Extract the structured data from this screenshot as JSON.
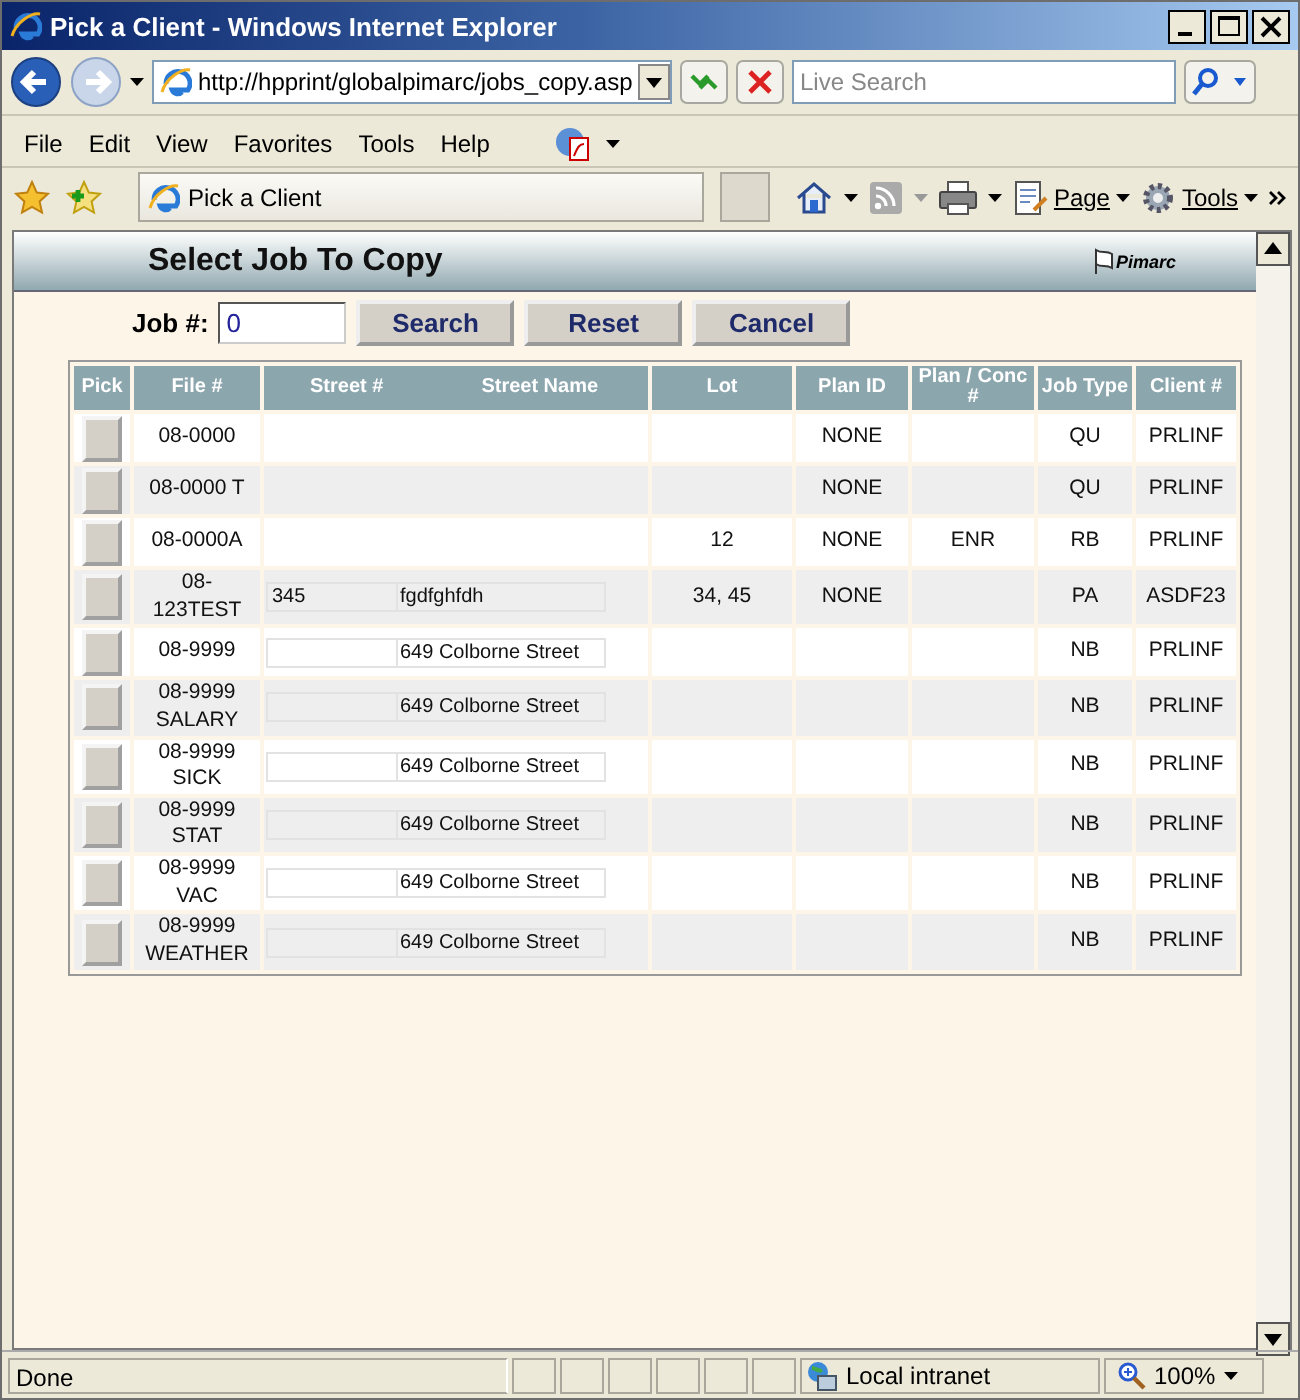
{
  "window": {
    "title": "Pick a Client - Windows Internet Explorer"
  },
  "address_bar": {
    "url": "http://hpprint/globalpimarc/jobs_copy.asp"
  },
  "search": {
    "placeholder": "Live Search"
  },
  "menu": [
    "File",
    "Edit",
    "View",
    "Favorites",
    "Tools",
    "Help"
  ],
  "favorites_bar": {
    "tab": "Pick a Client",
    "commands": [
      "Page",
      "Tools"
    ]
  },
  "page": {
    "title": "Select Job To Copy",
    "logo": "Pimarc",
    "form": {
      "label": "Job #:",
      "value": "0",
      "buttons": [
        "Search",
        "Reset",
        "Cancel"
      ]
    },
    "table": {
      "columns": [
        "Pick",
        "File #",
        "Street #",
        "Street Name",
        "Lot",
        "Plan ID",
        "Plan / Conc #",
        "Job Type",
        "Client #"
      ],
      "rows": [
        {
          "file": [
            "08-0000"
          ],
          "lot": "",
          "plan_id": "NONE",
          "plan_conc": "",
          "job_type": "QU",
          "client": "PRLINF"
        },
        {
          "file": [
            "08-0000 T"
          ],
          "lot": "",
          "plan_id": "NONE",
          "plan_conc": "",
          "job_type": "QU",
          "client": "PRLINF"
        },
        {
          "file": [
            "08-0000A"
          ],
          "lot": "12",
          "plan_id": "NONE",
          "plan_conc": "ENR",
          "job_type": "RB",
          "client": "PRLINF"
        },
        {
          "file": [
            "08-",
            "123TEST"
          ],
          "street_no": "345",
          "street_name": "fgdfghfdh",
          "lot": "34, 45",
          "plan_id": "NONE",
          "plan_conc": "",
          "job_type": "PA",
          "client": "ASDF23"
        },
        {
          "file": [
            "08-9999"
          ],
          "street_no": "",
          "street_name": "649 Colborne Street",
          "lot": "",
          "plan_id": "",
          "plan_conc": "",
          "job_type": "NB",
          "client": "PRLINF"
        },
        {
          "file": [
            "08-9999",
            "SALARY"
          ],
          "street_no": "",
          "street_name": "649 Colborne Street",
          "lot": "",
          "plan_id": "",
          "plan_conc": "",
          "job_type": "NB",
          "client": "PRLINF"
        },
        {
          "file": [
            "08-9999",
            "SICK"
          ],
          "street_no": "",
          "street_name": "649 Colborne Street",
          "lot": "",
          "plan_id": "",
          "plan_conc": "",
          "job_type": "NB",
          "client": "PRLINF"
        },
        {
          "file": [
            "08-9999",
            "STAT"
          ],
          "street_no": "",
          "street_name": "649 Colborne Street",
          "lot": "",
          "plan_id": "",
          "plan_conc": "",
          "job_type": "NB",
          "client": "PRLINF"
        },
        {
          "file": [
            "08-9999",
            "VAC"
          ],
          "street_no": "",
          "street_name": "649 Colborne Street",
          "lot": "",
          "plan_id": "",
          "plan_conc": "",
          "job_type": "NB",
          "client": "PRLINF"
        },
        {
          "file": [
            "08-9999",
            "WEATHER"
          ],
          "street_no": "",
          "street_name": "649 Colborne Street",
          "lot": "",
          "plan_id": "",
          "plan_conc": "",
          "job_type": "NB",
          "client": "PRLINF"
        }
      ]
    }
  },
  "status_bar": {
    "text": "Done",
    "zone": "Local intranet",
    "zoom": "100%"
  }
}
